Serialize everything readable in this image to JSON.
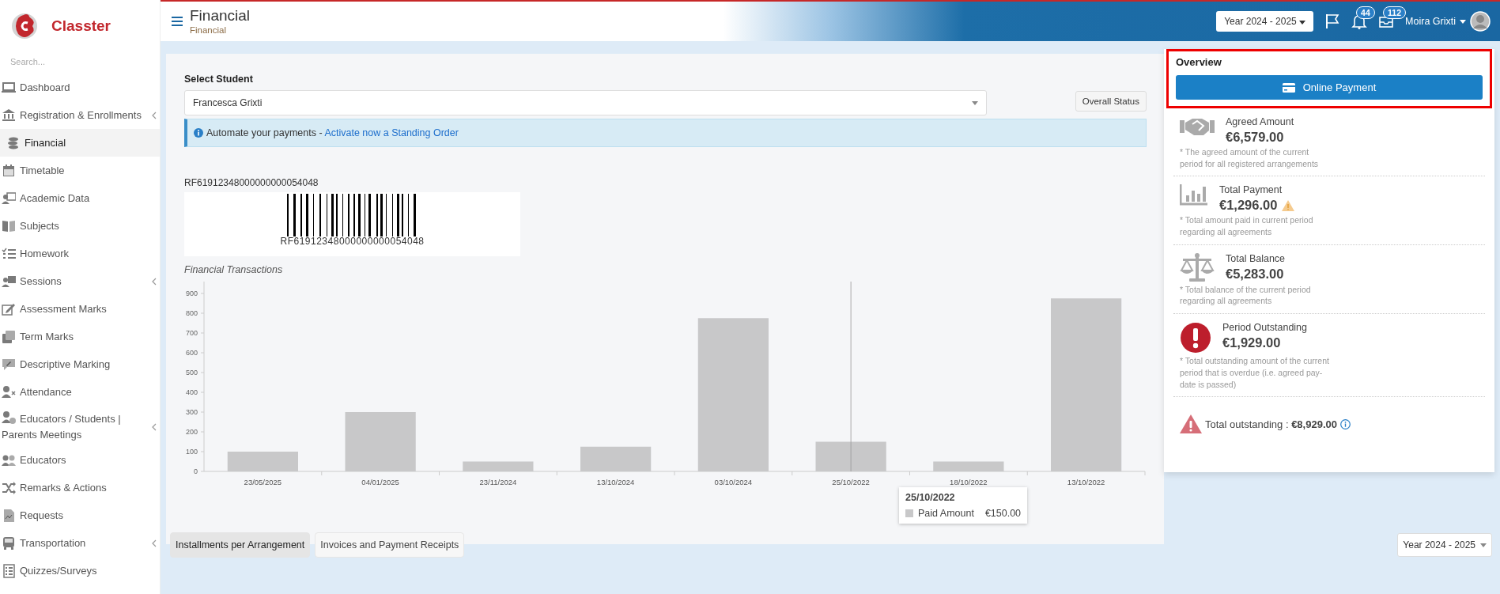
{
  "sidebar": {
    "logo": "Classter",
    "search": {
      "placeholder": "Search..."
    },
    "items": [
      {
        "label": "Dashboard",
        "selected": false,
        "expandable": false
      },
      {
        "label": "Registration & Enrollments",
        "selected": false,
        "expandable": true
      },
      {
        "label": "Financial",
        "selected": true,
        "expandable": false
      },
      {
        "label": "Timetable",
        "selected": false,
        "expandable": false
      },
      {
        "label": "Academic Data",
        "selected": false,
        "expandable": false
      },
      {
        "label": "Subjects",
        "selected": false,
        "expandable": false
      },
      {
        "label": "Homework",
        "selected": false,
        "expandable": false
      },
      {
        "label": "Sessions",
        "selected": false,
        "expandable": true
      },
      {
        "label": "Assessment Marks",
        "selected": false,
        "expandable": false
      },
      {
        "label": "Term Marks",
        "selected": false,
        "expandable": false
      },
      {
        "label": "Descriptive Marking",
        "selected": false,
        "expandable": false
      },
      {
        "label": "Attendance",
        "selected": false,
        "expandable": false
      },
      {
        "label": "Educators / Students | Parents Meetings",
        "selected": false,
        "expandable": true
      },
      {
        "label": "Educators",
        "selected": false,
        "expandable": false
      },
      {
        "label": "Remarks & Actions",
        "selected": false,
        "expandable": false
      },
      {
        "label": "Requests",
        "selected": false,
        "expandable": false
      },
      {
        "label": "Transportation",
        "selected": false,
        "expandable": true
      },
      {
        "label": "Quizzes/Surveys",
        "selected": false,
        "expandable": false
      }
    ]
  },
  "header": {
    "title": "Financial",
    "breadcrumb": "Financial",
    "year": "Year 2024 - 2025",
    "notifications": "44",
    "messages": "112",
    "user": "Moira Grixti"
  },
  "student": {
    "label": "Select Student",
    "value": "Francesca Grixti",
    "status_button": "Overall Status",
    "alert": {
      "text": "Automate your payments - ",
      "link": "Activate now a Standing Order"
    },
    "reference": "RF61912348000000000054048",
    "barcode_text": "RF61912348000000000054048"
  },
  "chart": {
    "chart_data": {
      "type": "bar",
      "title": "Financial Transactions",
      "categories": [
        "23/05/2025",
        "04/01/2025",
        "23/11/2024",
        "13/10/2024",
        "03/10/2024",
        "25/10/2022",
        "18/10/2022",
        "13/10/2022"
      ],
      "series": [
        {
          "name": "Paid Amount",
          "color": "#c8c8c9",
          "values": [
            100,
            300,
            50,
            125,
            775,
            150,
            50,
            875
          ]
        }
      ],
      "ylim": [
        0,
        960
      ],
      "ref_lines": [
        {
          "axis": "x",
          "value": "25/10/2022"
        }
      ],
      "yticks": [
        0,
        100,
        200,
        300,
        400,
        500,
        600,
        700,
        800,
        900
      ]
    },
    "tooltip": {
      "title": "25/10/2022",
      "value": "€150.00"
    }
  },
  "overview": {
    "title": "Overview",
    "highlighted": true,
    "payment_button": "Online Payment",
    "stats": [
      {
        "label": "Agreed Amount",
        "amount": "€6,579.00",
        "warning": false,
        "note": "* The agreed amount of the current period for all registered arrangements"
      },
      {
        "label": "Total Payment",
        "amount": "€1,296.00",
        "warning": true,
        "note": "* Total amount paid in current period regarding all agreements"
      },
      {
        "label": "Total Balance",
        "amount": "€5,283.00",
        "warning": false,
        "note": "* Total balance of the current period regarding all agreements"
      },
      {
        "label": "Period Outstanding",
        "amount": "€1,929.00",
        "warning": false,
        "note": "* Total outstanding amount of the current period that is overdue (i.e. agreed pay-date is passed)"
      }
    ],
    "total": "Total outstanding : **€8,929.00**"
  },
  "bottom": {
    "tabs": [
      {
        "label": "Installments per Arrangement",
        "selected": true
      },
      {
        "label": "Invoices and Payment Receipts",
        "selected": false
      }
    ],
    "year": "Year 2024 - 2025"
  }
}
